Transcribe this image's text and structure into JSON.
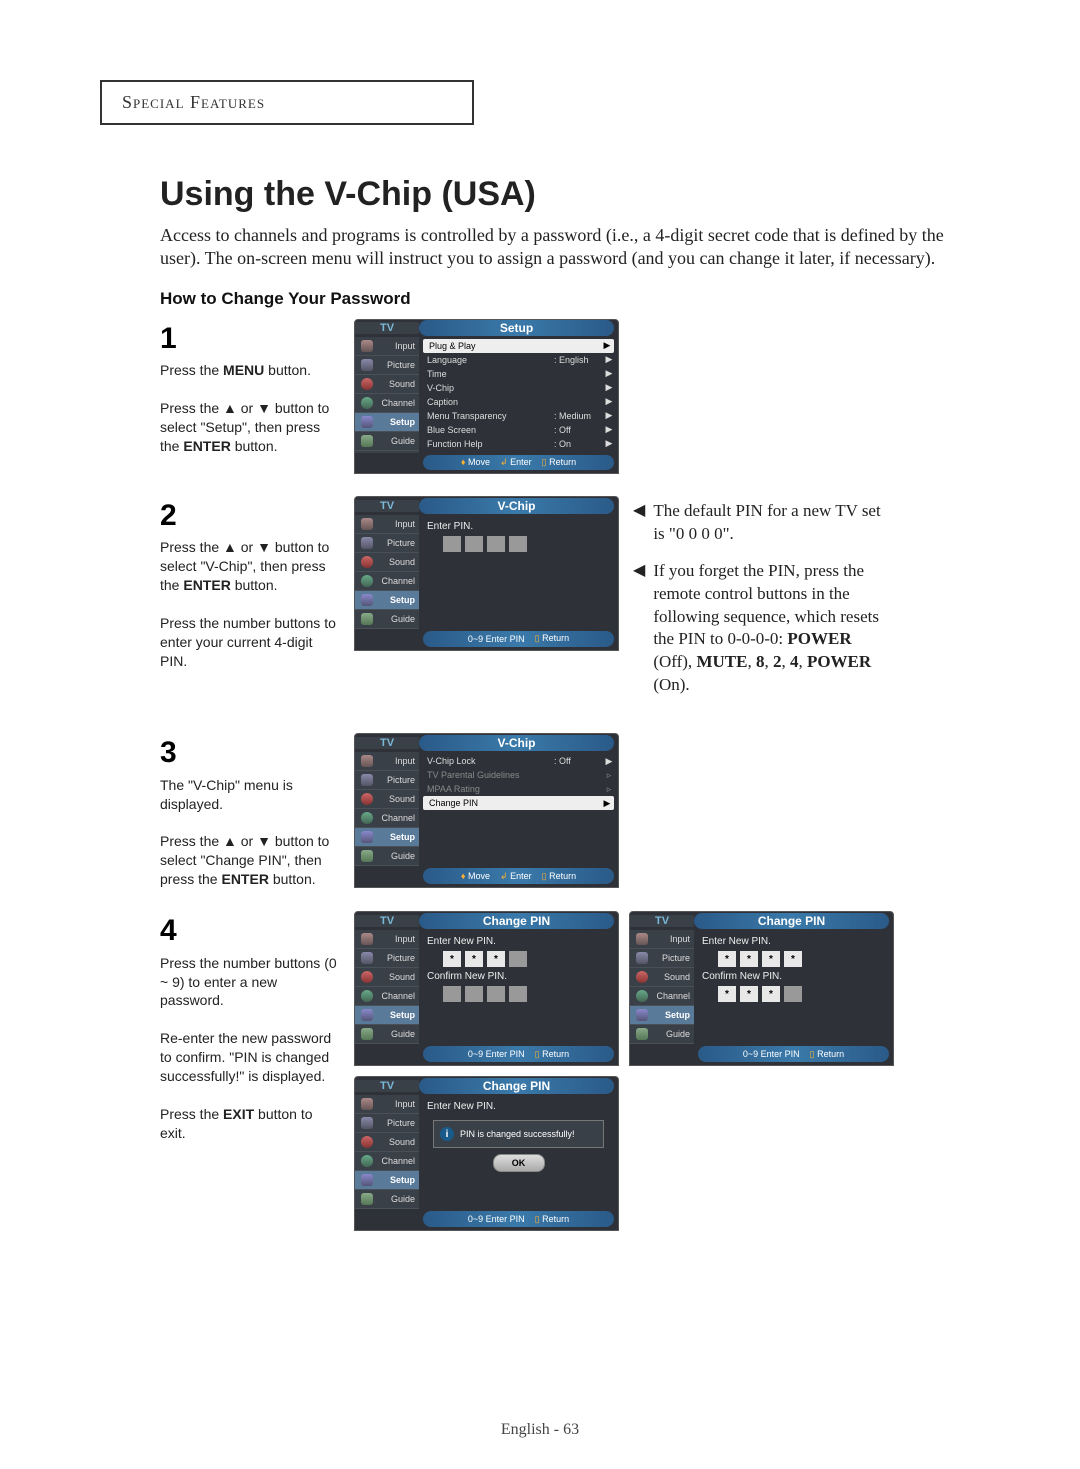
{
  "section_header": "Special Features",
  "title": "Using the V-Chip (USA)",
  "intro": "Access to channels and programs is controlled by a password (i.e., a 4-digit secret code that is defined by the user). The on-screen menu will instruct you to assign a password (and you can change it later, if necessary).",
  "subheading": "How to Change Your Password",
  "sidebar": {
    "input": "Input",
    "picture": "Picture",
    "sound": "Sound",
    "channel": "Channel",
    "setup": "Setup",
    "guide": "Guide"
  },
  "screen_tv": "TV",
  "footer_move": "Move",
  "footer_enter": "Enter",
  "footer_return": "Return",
  "footer_enter_pin": "Enter PIN",
  "footer_09": "0~9",
  "arrow": "▶",
  "steps": [
    {
      "num": "1",
      "text_html": "Press the <b>MENU</b> button.<br><br>Press the ▲ or ▼ button to select \"Setup\", then press the <b>ENTER</b> button."
    },
    {
      "num": "2",
      "text_html": "Press the ▲ or ▼ button to select \"V-Chip\", then press the <b>ENTER</b> button.<br><br>Press the number buttons to enter your current 4-digit PIN."
    },
    {
      "num": "3",
      "text_html": "The \"V-Chip\" menu is displayed.<br><br>Press the ▲ or ▼ button to select \"Change PIN\", then press the <b>ENTER</b> button."
    },
    {
      "num": "4",
      "text_html": "Press the number buttons (0 ~ 9) to enter a new password.<br><br>Re-enter the new password to confirm. \"PIN is changed successfully!\" is displayed.<br><br>Press the <b>EXIT</b> button to exit."
    }
  ],
  "screen1": {
    "title": "Setup",
    "items": [
      {
        "lbl": "Plug & Play",
        "val": "",
        "sel": true
      },
      {
        "lbl": "Language",
        "val": ": English"
      },
      {
        "lbl": "Time",
        "val": ""
      },
      {
        "lbl": "V-Chip",
        "val": ""
      },
      {
        "lbl": "Caption",
        "val": ""
      },
      {
        "lbl": "Menu Transparency",
        "val": ": Medium"
      },
      {
        "lbl": "Blue Screen",
        "val": ": Off"
      },
      {
        "lbl": "Function Help",
        "val": ": On"
      }
    ]
  },
  "screen2": {
    "title": "V-Chip",
    "label": "Enter PIN."
  },
  "screen3": {
    "title": "V-Chip",
    "items": [
      {
        "lbl": "V-Chip Lock",
        "val": ": Off",
        "dim": false
      },
      {
        "lbl": "TV Parental Guidelines",
        "val": "",
        "dim": true
      },
      {
        "lbl": "MPAA Rating",
        "val": "",
        "dim": true
      },
      {
        "lbl": "Change PIN",
        "val": "",
        "sel": true
      }
    ]
  },
  "screen4": {
    "title": "Change PIN",
    "enter_new": "Enter New PIN.",
    "confirm_new": "Confirm New PIN.",
    "success": "PIN is changed successfully!",
    "ok": "OK"
  },
  "notes": [
    "The default PIN for a new TV set is \"0 0 0 0\".",
    "If you forget the PIN, press the remote control buttons in the following sequence, which resets the PIN to 0-0-0-0: <b>POWER</b> (Off), <b>MUTE</b>, <b>8</b>, <b>2</b>, <b>4</b>, <b>POWER</b> (On)."
  ],
  "page_num": "English - 63",
  "star": "*"
}
